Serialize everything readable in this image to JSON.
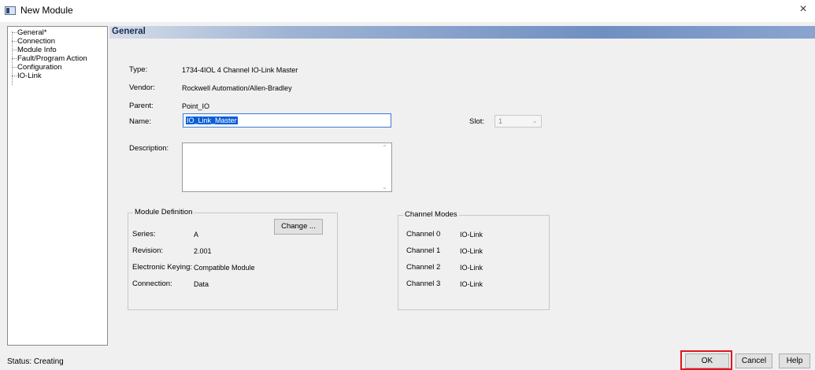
{
  "window": {
    "title": "New Module",
    "close": "×"
  },
  "tree": {
    "items": [
      {
        "label": "General*"
      },
      {
        "label": "Connection"
      },
      {
        "label": "Module Info"
      },
      {
        "label": "Fault/Program Action"
      },
      {
        "label": "Configuration"
      },
      {
        "label": "IO-Link"
      }
    ]
  },
  "panel": {
    "header": "General"
  },
  "general": {
    "type_label": "Type:",
    "type_value": "1734-4IOL 4 Channel IO-Link Master",
    "vendor_label": "Vendor:",
    "vendor_value": "Rockwell Automation/Allen-Bradley",
    "parent_label": "Parent:",
    "parent_value": "Point_IO",
    "name_label": "Name:",
    "name_value": "IO_Link_Master",
    "slot_label": "Slot:",
    "slot_value": "1",
    "description_label": "Description:",
    "description_value": ""
  },
  "module_definition": {
    "title": "Module Definition",
    "change_button": "Change ...",
    "rows": [
      {
        "label": "Series:",
        "value": "A"
      },
      {
        "label": "Revision:",
        "value": "2.001"
      },
      {
        "label": "Electronic Keying:",
        "value": "Compatible Module"
      },
      {
        "label": "Connection:",
        "value": "Data"
      }
    ]
  },
  "channel_modes": {
    "title": "Channel Modes",
    "rows": [
      {
        "label": "Channel 0",
        "value": "IO-Link"
      },
      {
        "label": "Channel 1",
        "value": "IO-Link"
      },
      {
        "label": "Channel 2",
        "value": "IO-Link"
      },
      {
        "label": "Channel 3",
        "value": "IO-Link"
      }
    ]
  },
  "status": {
    "text": "Status: Creating"
  },
  "buttons": {
    "ok": "OK",
    "cancel": "Cancel",
    "help": "Help"
  },
  "colors": {
    "highlight": "#e0141e",
    "selection": "#0a5fd6"
  }
}
